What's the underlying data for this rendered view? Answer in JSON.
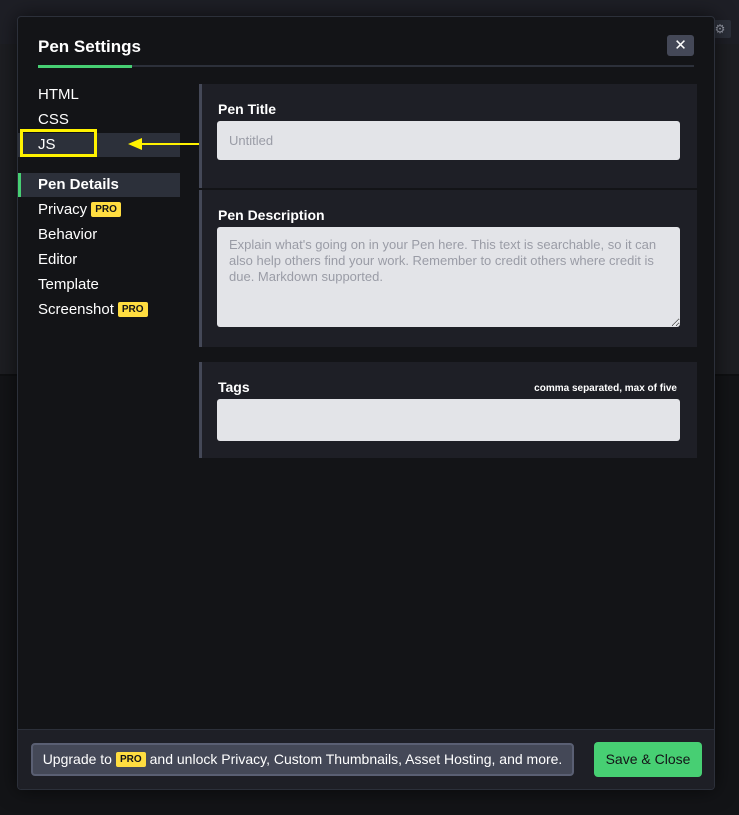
{
  "modal": {
    "title": "Pen Settings",
    "close_glyph": "✕"
  },
  "sidebar": {
    "items": [
      {
        "label": "HTML"
      },
      {
        "label": "CSS"
      },
      {
        "label": "JS"
      },
      {
        "label": "Pen Details"
      },
      {
        "label": "Privacy",
        "badge": "PRO"
      },
      {
        "label": "Behavior"
      },
      {
        "label": "Editor"
      },
      {
        "label": "Template"
      },
      {
        "label": "Screenshot",
        "badge": "PRO"
      }
    ]
  },
  "details": {
    "title_label": "Pen Title",
    "title_placeholder": "Untitled",
    "description_label": "Pen Description",
    "description_placeholder": "Explain what's going on in your Pen here. This text is searchable, so it can also help others find your work. Remember to credit others where credit is due. Markdown supported.",
    "tags_label": "Tags",
    "tags_note": "comma separated, max of five",
    "tags_value": ""
  },
  "footer": {
    "upgrade_prefix": "Upgrade to",
    "upgrade_badge": "PRO",
    "upgrade_suffix": "and unlock Privacy, Custom Thumbnails, Asset Hosting, and more.",
    "save_label": "Save & Close"
  },
  "colors": {
    "accent": "#47cf73",
    "pro_badge": "#ffdd40",
    "annotation": "#fff200"
  },
  "icons": {
    "close": "close-icon",
    "settings": "gear-icon"
  }
}
